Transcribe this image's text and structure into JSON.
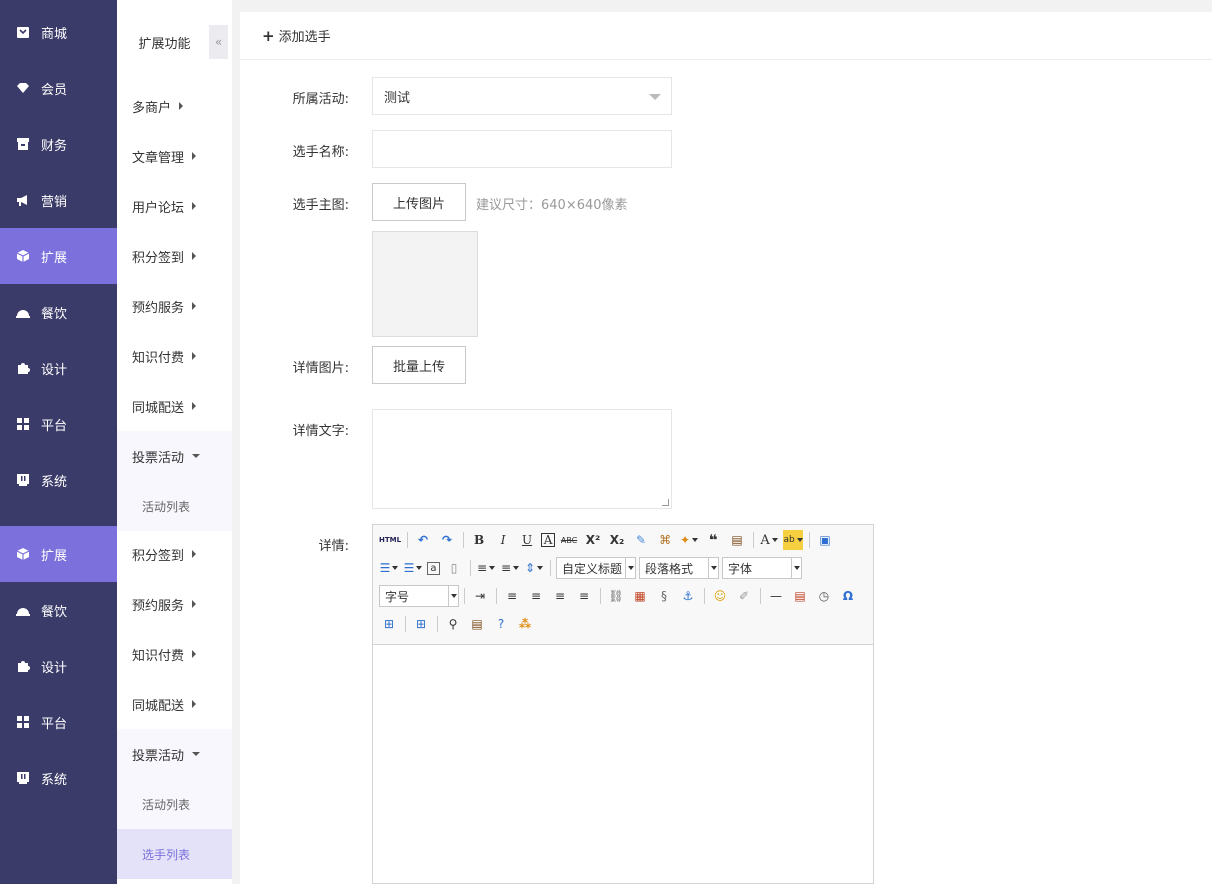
{
  "nav": {
    "items": [
      {
        "label": "商城",
        "icon": "store-icon"
      },
      {
        "label": "会员",
        "icon": "member-icon"
      },
      {
        "label": "财务",
        "icon": "finance-icon"
      },
      {
        "label": "营销",
        "icon": "megaphone-icon"
      },
      {
        "label": "扩展",
        "icon": "cube-icon"
      },
      {
        "label": "餐饮",
        "icon": "dish-icon"
      },
      {
        "label": "设计",
        "icon": "puzzle-icon"
      },
      {
        "label": "平台",
        "icon": "grid-icon"
      },
      {
        "label": "系统",
        "icon": "system-icon"
      },
      {
        "label": "扩展",
        "icon": "cube-icon"
      },
      {
        "label": "餐饮",
        "icon": "dish-icon"
      },
      {
        "label": "设计",
        "icon": "puzzle-icon"
      },
      {
        "label": "平台",
        "icon": "grid-icon"
      },
      {
        "label": "系统",
        "icon": "system-icon"
      }
    ],
    "active_color": "#7b70dc",
    "background": "#3b3b6a"
  },
  "submenu": {
    "title": "扩展功能",
    "collapse_glyph": "«",
    "items": [
      "多商户",
      "文章管理",
      "用户论坛",
      "积分签到",
      "预约服务",
      "知识付费",
      "同城配送",
      "投票活动",
      "活动列表",
      "积分签到",
      "预约服务",
      "知识付费",
      "同城配送",
      "投票活动",
      "活动列表",
      "选手列表"
    ]
  },
  "header": {
    "add_label": "添加选手"
  },
  "form": {
    "activity_label": "所属活动:",
    "activity_value": "测试",
    "name_label": "选手名称:",
    "name_value": "",
    "main_image_label": "选手主图:",
    "upload_button": "上传图片",
    "size_hint": "建议尺寸：640×640像素",
    "detail_images_label": "详情图片:",
    "batch_upload_button": "批量上传",
    "detail_text_label": "详情文字:",
    "detail_text_value": "",
    "detail_label": "详情:"
  },
  "editor": {
    "html_label": "HTML",
    "custom_title": "自定义标题",
    "paragraph_format": "段落格式",
    "font_family": "字体",
    "font_size": "字号"
  }
}
